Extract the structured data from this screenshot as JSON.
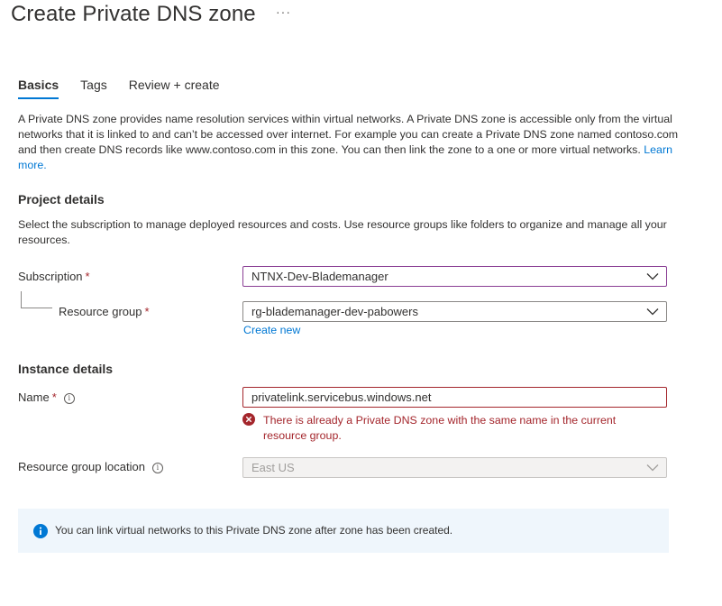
{
  "header": {
    "title": "Create Private DNS zone",
    "more_label": "···"
  },
  "tabs": [
    {
      "label": "Basics",
      "active": true
    },
    {
      "label": "Tags",
      "active": false
    },
    {
      "label": "Review + create",
      "active": false
    }
  ],
  "intro": {
    "text": "A Private DNS zone provides name resolution services within virtual networks. A Private DNS zone is accessible only from the virtual networks that it is linked to and can’t be accessed over internet. For example you can create a Private DNS zone named contoso.com and then create DNS records like www.contoso.com in this zone. You can then link the zone to a one or more virtual networks.",
    "learn_more": "Learn more."
  },
  "project_details": {
    "heading": "Project details",
    "description": "Select the subscription to manage deployed resources and costs. Use resource groups like folders to organize and manage all your resources.",
    "subscription": {
      "label": "Subscription",
      "required_mark": "*",
      "value": "NTNX-Dev-Blademanager"
    },
    "resource_group": {
      "label": "Resource group",
      "required_mark": "*",
      "value": "rg-blademanager-dev-pabowers",
      "create_new": "Create new"
    }
  },
  "instance_details": {
    "heading": "Instance details",
    "name": {
      "label": "Name",
      "required_mark": "*",
      "info_icon": "info-icon",
      "value": "privatelink.servicebus.windows.net",
      "error": "There is already a Private DNS zone with the same name in the current resource group."
    },
    "location": {
      "label": "Resource group location",
      "info_icon": "info-icon",
      "value": "East US",
      "disabled": true
    }
  },
  "banner": {
    "icon": "info-filled-icon",
    "text": "You can link virtual networks to this Private DNS zone after zone has been created."
  },
  "colors": {
    "accent": "#0078d4",
    "error": "#a4262c",
    "focus_border": "#8a3f94",
    "banner_bg": "#eff6fc"
  }
}
